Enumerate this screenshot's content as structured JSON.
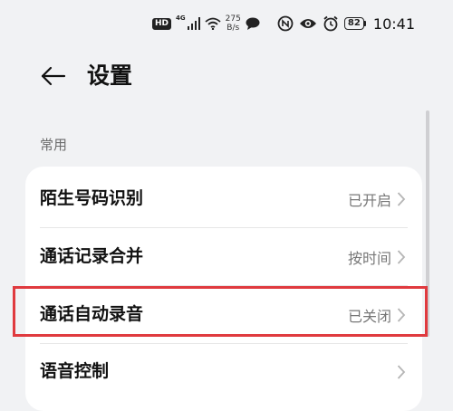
{
  "status_bar": {
    "hd_badge": "HD",
    "network_type": "4G",
    "speed_value": "275",
    "speed_unit": "B/s",
    "battery_level": "82",
    "time": "10:41",
    "icons": [
      "hd-icon",
      "cellular-signal-icon",
      "wifi-icon",
      "message-bubble-icon",
      "nfc-icon",
      "eye-icon",
      "alarm-icon",
      "battery-icon"
    ]
  },
  "header": {
    "back_icon": "arrow-left-icon",
    "title": "设置"
  },
  "section": {
    "label": "常用"
  },
  "rows": [
    {
      "label": "陌生号码识别",
      "value": "已开启"
    },
    {
      "label": "通话记录合并",
      "value": "按时间"
    },
    {
      "label": "通话自动录音",
      "value": "已关闭"
    },
    {
      "label": "语音控制",
      "value": ""
    }
  ],
  "annotation": {
    "highlight_color": "#e03a3f",
    "highlighted_row": "通话自动录音"
  }
}
